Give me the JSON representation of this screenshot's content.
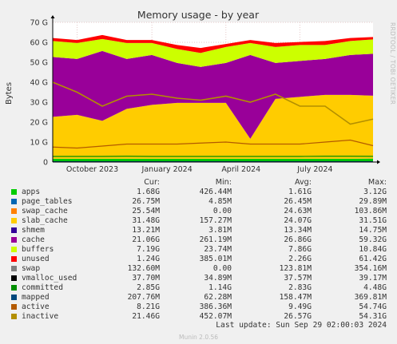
{
  "chart_data": {
    "type": "area",
    "title": "Memory usage - by year",
    "ylabel": "Bytes",
    "ylim": [
      0,
      70
    ],
    "yunit": "G",
    "yticks": [
      "0",
      "10 G",
      "20 G",
      "30 G",
      "40 G",
      "50 G",
      "60 G",
      "70 G"
    ],
    "xticks": [
      "October 2023",
      "January 2024",
      "April 2024",
      "July 2024"
    ],
    "grid": true,
    "x": [
      "2023-09-01",
      "2023-10-01",
      "2023-11-01",
      "2023-12-01",
      "2024-01-01",
      "2024-02-01",
      "2024-03-01",
      "2024-04-01",
      "2024-05-01",
      "2024-06-01",
      "2024-07-01",
      "2024-08-01",
      "2024-09-01",
      "2024-09-29"
    ],
    "stacked_series": [
      {
        "name": "apps",
        "color": "#00cc00",
        "values": [
          1.6,
          1.6,
          1.6,
          1.6,
          1.6,
          1.6,
          1.6,
          1.6,
          1.6,
          1.6,
          1.6,
          1.6,
          1.6,
          1.7
        ]
      },
      {
        "name": "page_tables",
        "color": "#0066b3",
        "values": [
          0.03,
          0.03,
          0.03,
          0.03,
          0.03,
          0.03,
          0.03,
          0.03,
          0.03,
          0.03,
          0.03,
          0.03,
          0.03,
          0.03
        ]
      },
      {
        "name": "swap_cache",
        "color": "#ff8000",
        "values": [
          0.03,
          0.03,
          0.03,
          0.03,
          0.03,
          0.03,
          0.03,
          0.03,
          0.03,
          0.03,
          0.03,
          0.03,
          0.03,
          0.03
        ]
      },
      {
        "name": "slab_cache",
        "color": "#ffcc00",
        "values": [
          21,
          22,
          19,
          25,
          27,
          28,
          28,
          28,
          10,
          30,
          31,
          32,
          32,
          31.5
        ]
      },
      {
        "name": "shmem",
        "color": "#330099",
        "values": [
          0.013,
          0.013,
          0.013,
          0.013,
          0.013,
          0.013,
          0.013,
          0.013,
          0.013,
          0.013,
          0.013,
          0.013,
          0.013,
          0.013
        ]
      },
      {
        "name": "cache",
        "color": "#990099",
        "values": [
          30,
          28,
          35,
          25,
          25,
          20,
          18,
          20,
          42,
          18,
          18,
          18,
          20,
          21
        ]
      },
      {
        "name": "buffers",
        "color": "#ccff00",
        "values": [
          8,
          8,
          6,
          8,
          6,
          7,
          7,
          8,
          6,
          8,
          8,
          7,
          7,
          7.2
        ]
      },
      {
        "name": "unused",
        "color": "#ff0000",
        "values": [
          1.5,
          1.5,
          2,
          1.5,
          1.5,
          2,
          2.5,
          1.5,
          1.5,
          2,
          1.5,
          2,
          1.5,
          1.2
        ]
      }
    ],
    "line_series": [
      {
        "name": "swap",
        "color": "#808080",
        "values": [
          0.1,
          0.1,
          0.1,
          0.1,
          0.1,
          0.1,
          0.1,
          0.1,
          0.1,
          0.1,
          0.1,
          0.1,
          0.1,
          0.13
        ]
      },
      {
        "name": "vmalloc_used",
        "color": "#000000",
        "values": [
          0.04,
          0.04,
          0.04,
          0.04,
          0.04,
          0.04,
          0.04,
          0.04,
          0.04,
          0.04,
          0.04,
          0.04,
          0.04,
          0.04
        ]
      },
      {
        "name": "committed",
        "color": "#008f00",
        "values": [
          2.8,
          2.8,
          2.8,
          2.9,
          2.8,
          2.8,
          2.8,
          2.8,
          2.8,
          2.8,
          2.8,
          2.9,
          2.9,
          2.85
        ]
      },
      {
        "name": "mapped",
        "color": "#00487d",
        "values": [
          0.2,
          0.2,
          0.2,
          0.2,
          0.2,
          0.2,
          0.2,
          0.2,
          0.2,
          0.2,
          0.2,
          0.2,
          0.2,
          0.21
        ]
      },
      {
        "name": "active",
        "color": "#b35a00",
        "values": [
          7.5,
          7,
          8,
          9,
          9,
          9,
          9.5,
          10,
          9,
          9,
          9,
          10,
          11,
          8.2
        ]
      },
      {
        "name": "inactive",
        "color": "#b38f00",
        "values": [
          40,
          35,
          28,
          33,
          34,
          32,
          31,
          33,
          30,
          34,
          28,
          28,
          19,
          21.5
        ]
      }
    ],
    "table": {
      "headers": [
        "Cur:",
        "Min:",
        "Avg:",
        "Max:"
      ],
      "rows": [
        {
          "name": "apps",
          "color": "#00cc00",
          "cur": "1.68G",
          "min": "426.44M",
          "avg": "1.61G",
          "max": "3.12G"
        },
        {
          "name": "page_tables",
          "color": "#0066b3",
          "cur": "26.75M",
          "min": "4.85M",
          "avg": "26.45M",
          "max": "29.89M"
        },
        {
          "name": "swap_cache",
          "color": "#ff8000",
          "cur": "25.54M",
          "min": "0.00",
          "avg": "24.63M",
          "max": "103.86M"
        },
        {
          "name": "slab_cache",
          "color": "#ffcc00",
          "cur": "31.48G",
          "min": "157.27M",
          "avg": "24.07G",
          "max": "31.51G"
        },
        {
          "name": "shmem",
          "color": "#330099",
          "cur": "13.21M",
          "min": "3.81M",
          "avg": "13.34M",
          "max": "14.75M"
        },
        {
          "name": "cache",
          "color": "#990099",
          "cur": "21.06G",
          "min": "261.19M",
          "avg": "26.86G",
          "max": "59.32G"
        },
        {
          "name": "buffers",
          "color": "#ccff00",
          "cur": "7.19G",
          "min": "23.74M",
          "avg": "7.86G",
          "max": "10.84G"
        },
        {
          "name": "unused",
          "color": "#ff0000",
          "cur": "1.24G",
          "min": "385.01M",
          "avg": "2.26G",
          "max": "61.42G"
        },
        {
          "name": "swap",
          "color": "#808080",
          "cur": "132.60M",
          "min": "0.00",
          "avg": "123.81M",
          "max": "354.16M"
        },
        {
          "name": "vmalloc_used",
          "color": "#000000",
          "cur": "37.70M",
          "min": "34.89M",
          "avg": "37.57M",
          "max": "39.17M"
        },
        {
          "name": "committed",
          "color": "#008f00",
          "cur": "2.85G",
          "min": "1.14G",
          "avg": "2.83G",
          "max": "4.48G"
        },
        {
          "name": "mapped",
          "color": "#00487d",
          "cur": "207.76M",
          "min": "62.28M",
          "avg": "158.47M",
          "max": "369.81M"
        },
        {
          "name": "active",
          "color": "#b35a00",
          "cur": "8.21G",
          "min": "386.36M",
          "avg": "9.49G",
          "max": "54.74G"
        },
        {
          "name": "inactive",
          "color": "#b38f00",
          "cur": "21.46G",
          "min": "452.07M",
          "avg": "26.57G",
          "max": "54.31G"
        }
      ]
    }
  },
  "footer": {
    "last_update": "Last update: Sun Sep 29 02:00:03 2024",
    "munin_version": "Munin 2.0.56",
    "rrdtool": "RRDTOOL / TOBI OETIKER"
  }
}
